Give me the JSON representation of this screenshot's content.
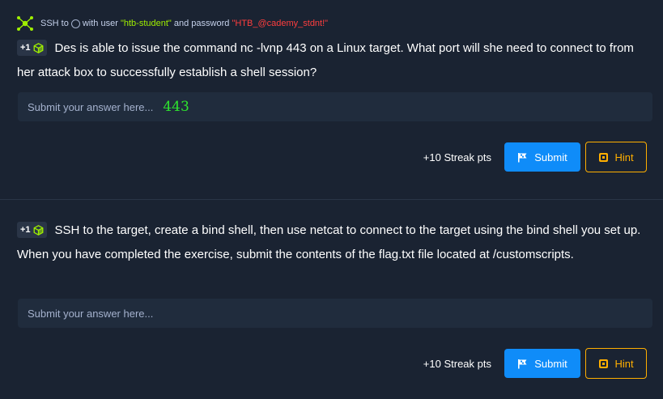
{
  "ssh": {
    "prefix": "SSH to",
    "with_user": "with user",
    "username": "\"htb-student\"",
    "and_password": "and password",
    "password": "\"HTB_@cademy_stdnt!\""
  },
  "questions": [
    {
      "badge": "+1",
      "text": "Des is able to issue the command nc -lvnp 443 on a Linux target. What port will she need to connect to from her attack box to successfully establish a shell session?",
      "placeholder": "Submit your answer here...",
      "answer": "443",
      "streak": "+10 Streak pts",
      "submit_label": "Submit",
      "hint_label": "Hint"
    },
    {
      "badge": "+1",
      "text": "SSH to the target, create a bind shell, then use netcat to connect to the target using the bind shell you set up. When you have completed the exercise, submit the contents of the flag.txt file located at /customscripts.",
      "placeholder": "Submit your answer here...",
      "answer": "",
      "streak": "+10 Streak pts",
      "submit_label": "Submit",
      "hint_label": "Hint"
    }
  ],
  "colors": {
    "background": "#1a2332",
    "accent_green": "#9fef00",
    "accent_red": "#ff3e3e",
    "submit_blue": "#0f8cf9",
    "hint_orange": "#ffaf00"
  }
}
